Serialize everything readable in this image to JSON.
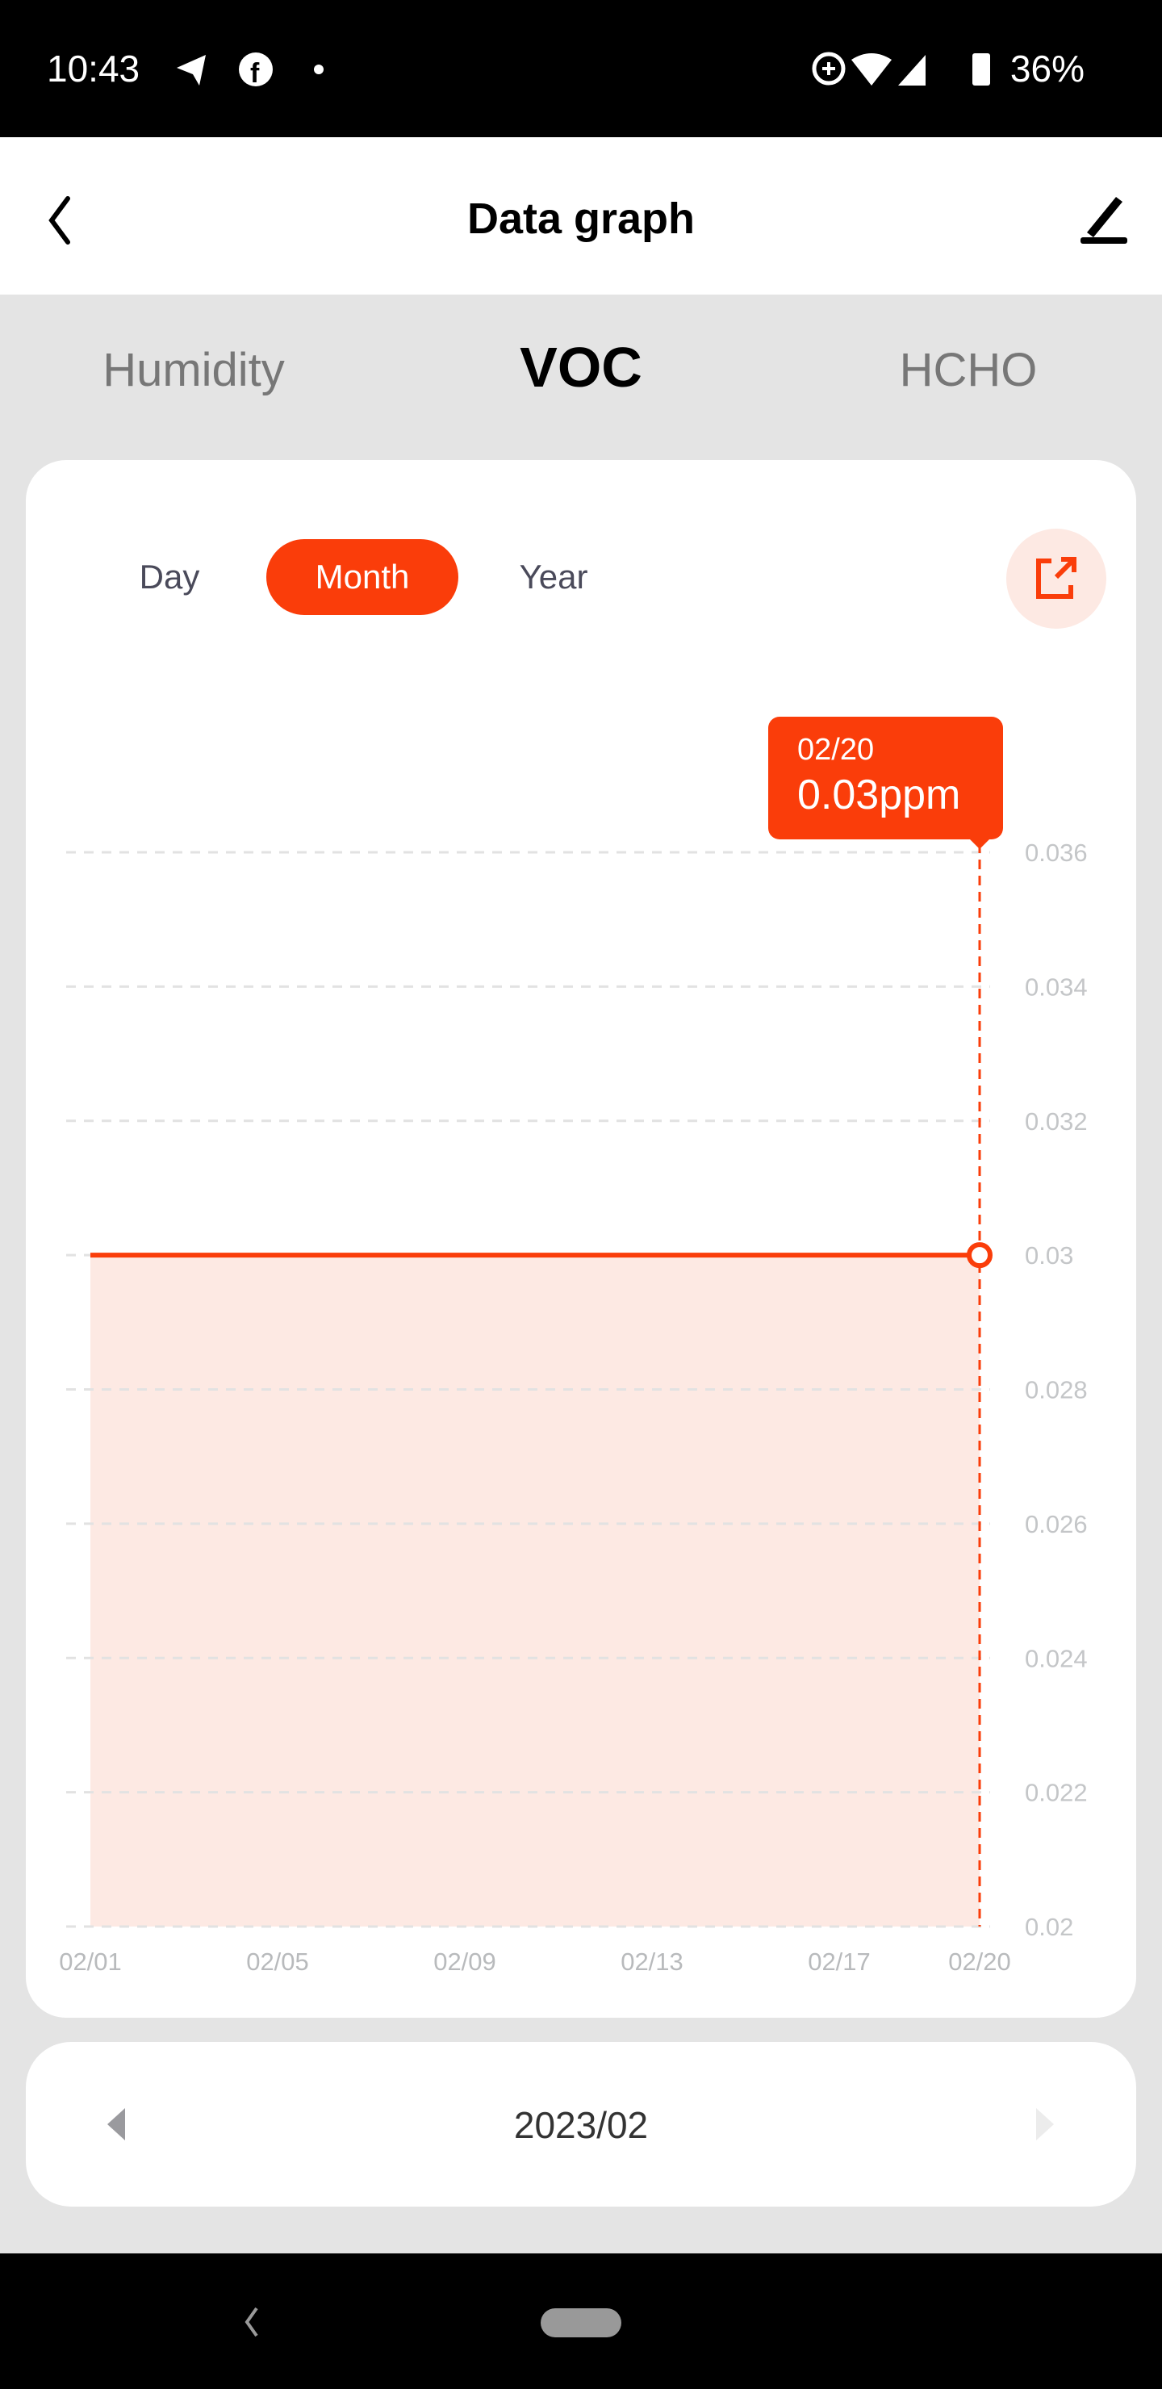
{
  "status_bar": {
    "time": "10:43",
    "battery": "36%",
    "icons": [
      "telegram-icon",
      "facebook-icon",
      "dot-icon",
      "data-saver-icon",
      "wifi-icon",
      "signal-icon",
      "battery-charging-icon"
    ]
  },
  "header": {
    "title": "Data graph",
    "back_icon": "chevron-left-icon",
    "edit_icon": "pencil-icon"
  },
  "tabs": [
    {
      "label": "Humidity",
      "active": false
    },
    {
      "label": "VOC",
      "active": true
    },
    {
      "label": "HCHO",
      "active": false
    }
  ],
  "range_tabs": [
    {
      "label": "Day",
      "active": false
    },
    {
      "label": "Month",
      "active": true
    },
    {
      "label": "Year",
      "active": false
    }
  ],
  "export_icon": "share-external-icon",
  "accent_color": "#fa3d0a",
  "tooltip": {
    "date": "02/20",
    "value": "0.03ppm"
  },
  "chart_data": {
    "type": "area",
    "x_tick_labels": [
      "02/01",
      "02/05",
      "02/09",
      "02/13",
      "02/17",
      "02/20"
    ],
    "y_tick_labels": [
      "0.036",
      "0.034",
      "0.032",
      "0.03",
      "0.028",
      "0.026",
      "0.024",
      "0.022",
      "0.02"
    ],
    "ylim": [
      0.02,
      0.036
    ],
    "grid": true,
    "y_axis_position": "right",
    "points": [
      {
        "x": "02/01",
        "y": 0.03
      },
      {
        "x": "02/20",
        "y": 0.03
      }
    ],
    "selected": {
      "x": "02/20",
      "y": 0.03
    }
  },
  "pager": {
    "period": "2023/02",
    "prev_icon": "triangle-left-icon",
    "next_icon": "triangle-right-icon"
  },
  "nav_bar": {
    "back_icon": "back-icon",
    "home_icon": "home-pill-icon"
  }
}
